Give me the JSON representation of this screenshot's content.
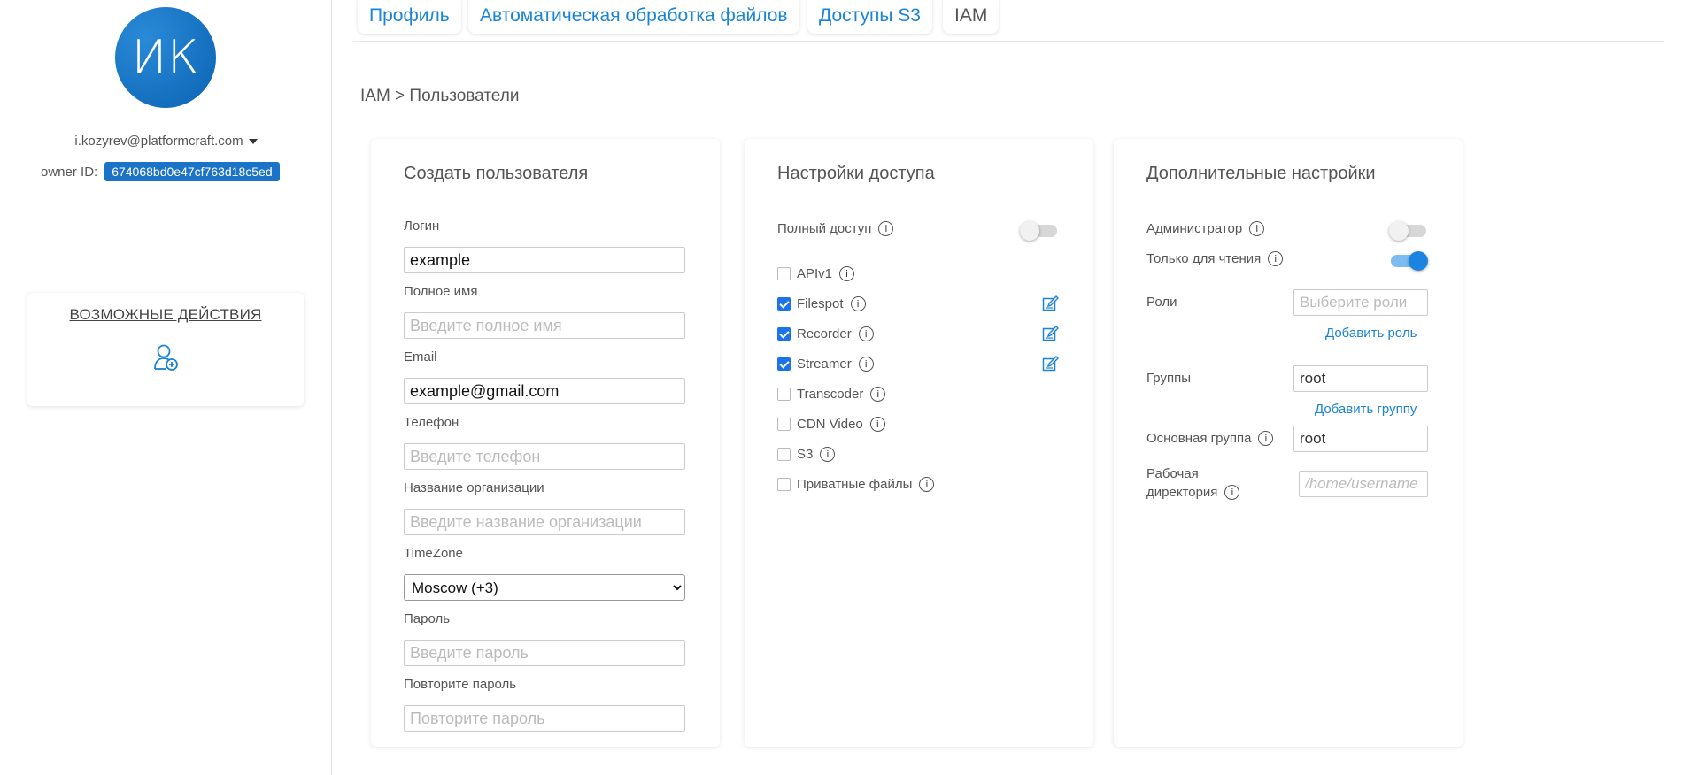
{
  "sidebar": {
    "avatar_initials": "ИК",
    "user_email": "i.kozyrev@platformcraft.com",
    "owner_label": "owner ID:",
    "owner_id": "674068bd0e47cf763d18c5ed",
    "actions_title": "ВОЗМОЖНЫЕ ДЕЙСТВИЯ",
    "add_user_icon": "add-user-icon"
  },
  "tabs": [
    {
      "label": "Профиль",
      "active": false
    },
    {
      "label": "Автоматическая обработка файлов",
      "active": false
    },
    {
      "label": "Доступы S3",
      "active": false
    },
    {
      "label": "IAM",
      "active": true
    }
  ],
  "breadcrumb": "IAM > Пользователи",
  "create_user": {
    "title": "Создать пользователя",
    "login_label": "Логин",
    "login_value": "example",
    "fullname_label": "Полное имя",
    "fullname_placeholder": "Введите полное имя",
    "email_label": "Email",
    "email_value": "example@gmail.com",
    "phone_label": "Телефон",
    "phone_placeholder": "Введите телефон",
    "org_label": "Название организации",
    "org_placeholder": "Введите название организации",
    "timezone_label": "TimeZone",
    "timezone_value": "Moscow (+3)",
    "password_label": "Пароль",
    "password_placeholder": "Введите пароль",
    "password_repeat_label": "Повторите пароль",
    "password_repeat_placeholder": "Повторите пароль"
  },
  "access": {
    "title": "Настройки доступа",
    "full_access_label": "Полный доступ",
    "full_access_on": false,
    "items": [
      {
        "label": "APIv1",
        "checked": false,
        "editable": false
      },
      {
        "label": "Filespot",
        "checked": true,
        "editable": true
      },
      {
        "label": "Recorder",
        "checked": true,
        "editable": true
      },
      {
        "label": "Streamer",
        "checked": true,
        "editable": true
      },
      {
        "label": "Transcoder",
        "checked": false,
        "editable": false
      },
      {
        "label": "CDN Video",
        "checked": false,
        "editable": false
      },
      {
        "label": "S3",
        "checked": false,
        "editable": false
      },
      {
        "label": "Приватные файлы",
        "checked": false,
        "editable": false
      }
    ]
  },
  "extra": {
    "title": "Дополнительные настройки",
    "admin_label": "Администратор",
    "admin_on": false,
    "readonly_label": "Только для чтения",
    "readonly_on": true,
    "roles_label": "Роли",
    "roles_placeholder": "Выберите роли",
    "add_role": "Добавить роль",
    "groups_label": "Группы",
    "groups_value": "root",
    "add_group": "Добавить группу",
    "main_group_label": "Основная группа",
    "main_group_value": "root",
    "workdir_label_1": "Рабочая",
    "workdir_label_2": "директория",
    "workdir_placeholder": "/home/username"
  },
  "colors": {
    "accent": "#1a84d8",
    "owner_badge": "#1a73c7",
    "toggle_on": "#1a84e0"
  }
}
